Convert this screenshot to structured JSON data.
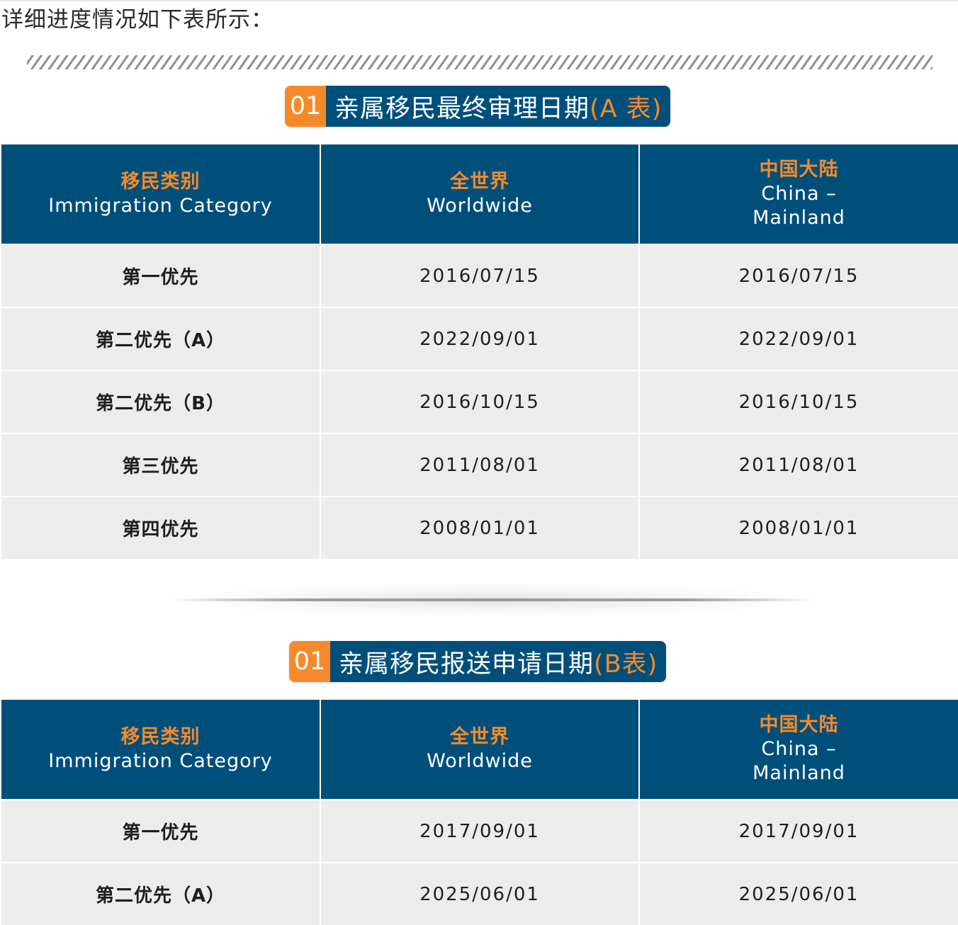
{
  "intro_text": "详细进度情况如下表所示：",
  "colors": {
    "accent_orange": "#f68a2b",
    "header_blue": "#004f7b",
    "row_gray": "#ececec"
  },
  "tables": [
    {
      "badge_number": "01",
      "badge_title": "亲属移民最终审理日期",
      "badge_suffix": "(A 表)",
      "headers": [
        {
          "zh": "移民类别",
          "en": "Immigration Category"
        },
        {
          "zh": "全世界",
          "en": "Worldwide"
        },
        {
          "zh": "中国大陆",
          "en": "China –\nMainland"
        }
      ],
      "rows": [
        {
          "category": "第一优先",
          "worldwide": "2016/07/15",
          "china": "2016/07/15"
        },
        {
          "category": "第二优先（A）",
          "worldwide": "2022/09/01",
          "china": "2022/09/01"
        },
        {
          "category": "第二优先（B）",
          "worldwide": "2016/10/15",
          "china": "2016/10/15"
        },
        {
          "category": "第三优先",
          "worldwide": "2011/08/01",
          "china": "2011/08/01"
        },
        {
          "category": "第四优先",
          "worldwide": "2008/01/01",
          "china": "2008/01/01"
        }
      ]
    },
    {
      "badge_number": "01",
      "badge_title": "亲属移民报送申请日期",
      "badge_suffix": "(B表)",
      "headers": [
        {
          "zh": "移民类别",
          "en": "Immigration Category"
        },
        {
          "zh": "全世界",
          "en": "Worldwide"
        },
        {
          "zh": "中国大陆",
          "en": "China –\nMainland"
        }
      ],
      "rows": [
        {
          "category": "第一优先",
          "worldwide": "2017/09/01",
          "china": "2017/09/01"
        },
        {
          "category": "第二优先（A）",
          "worldwide": "2025/06/01",
          "china": "2025/06/01"
        }
      ]
    }
  ]
}
